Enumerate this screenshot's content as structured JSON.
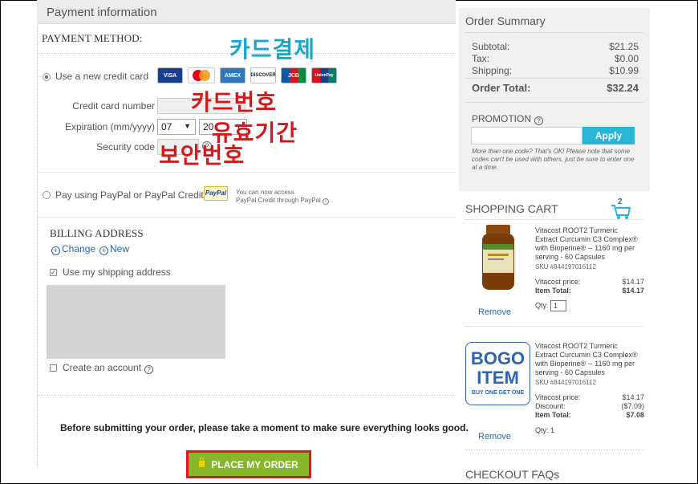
{
  "payment": {
    "header": "Payment information",
    "method_heading": "PAYMENT METHOD:",
    "new_card_label": "Use a new credit card",
    "cards": [
      "VISA",
      "MasterCard",
      "AMEX",
      "DISCOVER",
      "JCB",
      "UnionPay"
    ],
    "card_number_label": "Credit card number",
    "expiration_label": "Expiration (mm/yyyy)",
    "exp_month": "07",
    "exp_year": "20",
    "security_code_label": "Security code",
    "paypal_label": "Pay using PayPal or PayPal Credit",
    "paypal_logo": "PayPal",
    "paypal_note_1": "You can now access",
    "paypal_note_2": "PayPal Credit through PayPal"
  },
  "annotations": {
    "card_payment": "카드결제",
    "card_number": "카드번호",
    "expiry": "유효기간",
    "security": "보안번호"
  },
  "billing": {
    "heading": "BILLING ADDRESS",
    "change_link": "Change",
    "new_link": "New",
    "use_shipping_label": "Use my shipping address",
    "create_account_label": "Create an account"
  },
  "footer": {
    "notice": "Before submitting your order, please take a moment to make sure everything looks good.",
    "place_order": "PLACE MY ORDER"
  },
  "summary": {
    "title": "Order Summary",
    "subtotal_label": "Subtotal:",
    "subtotal": "$21.25",
    "tax_label": "Tax:",
    "tax": "$0.00",
    "shipping_label": "Shipping:",
    "shipping": "$10.99",
    "total_label": "Order Total:",
    "total": "$32.24",
    "promo_label": "PROMOTION",
    "apply": "Apply",
    "promo_note": "More than one code? That's OK! Please note that some codes can't be used with others, just be sure to enter one at a time."
  },
  "cart": {
    "title": "SHOPPING CART",
    "count": "2",
    "items": [
      {
        "name_1": "Vitacost ROOT2 Turmeric",
        "name_2": "Extract Curcumin C3 Complex®",
        "name_3": "with Bioperine® -- 1160 mg per",
        "name_4": "serving - 60 Capsules",
        "sku": "SKU #844197016112",
        "price_label": "Vitacost price:",
        "price": "$14.17",
        "total_label": "Item Total:",
        "total": "$14.17",
        "qty_label": "Qty:",
        "qty": "1",
        "remove": "Remove"
      },
      {
        "name_1": "Vitacost ROOT2 Turmeric",
        "name_2": "Extract Curcumin C3 Complex®",
        "name_3": "with Bioperine® -- 1160 mg per",
        "name_4": "serving - 60 Capsules",
        "sku": "SKU #844197016112",
        "price_label": "Vitacost price:",
        "price": "$14.17",
        "discount_label": "Discount:",
        "discount": "($7.09)",
        "total_label": "Item Total:",
        "total": "$7.08",
        "qty_label": "Qty: 1",
        "remove": "Remove",
        "bogo_1": "BOGO",
        "bogo_2": "ITEM",
        "bogo_3": "BUY ONE GET ONE"
      }
    ],
    "faq_title": "CHECKOUT FAQs"
  }
}
